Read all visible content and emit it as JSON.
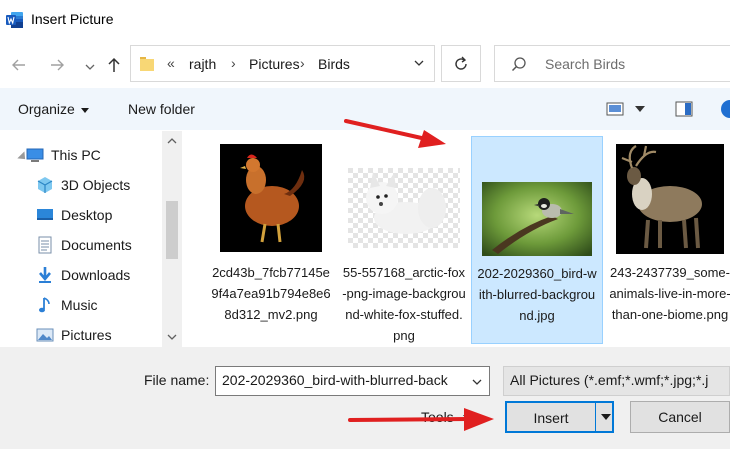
{
  "window": {
    "title": "Insert Picture",
    "app_icon": "word-icon"
  },
  "nav": {
    "back_icon": "back-arrow-icon",
    "forward_icon": "forward-arrow-icon",
    "up_icon": "up-arrow-icon",
    "overflow": "«",
    "breadcrumb": [
      "rajth",
      "Pictures",
      "Birds"
    ],
    "search_placeholder": "Search Birds"
  },
  "toolbar": {
    "organize_label": "Organize",
    "new_folder_label": "New folder"
  },
  "sidebar": {
    "items": [
      {
        "label": "This PC",
        "icon": "computer-icon"
      },
      {
        "label": "3D Objects",
        "icon": "cube-icon"
      },
      {
        "label": "Desktop",
        "icon": "desktop-icon"
      },
      {
        "label": "Documents",
        "icon": "document-icon"
      },
      {
        "label": "Downloads",
        "icon": "download-icon"
      },
      {
        "label": "Music",
        "icon": "music-note-icon"
      },
      {
        "label": "Pictures",
        "icon": "pictures-icon"
      }
    ]
  },
  "files": [
    {
      "name": "2cd43b_7fcb77145e9f4a7ea91b794e8e68d312_mv2.png",
      "selected": false
    },
    {
      "name": "55-557168_arctic-fox-png-image-background-white-fox-stuffed.png",
      "selected": false
    },
    {
      "name": "202-2029360_bird-with-blurred-background.jpg",
      "selected": true
    },
    {
      "name": "243-2437739_some-animals-live-in-more-than-one-biome.png",
      "selected": false
    }
  ],
  "footer": {
    "file_name_label": "File name:",
    "file_name_value": "202-2029360_bird-with-blurred-back",
    "filter_value": "All Pictures (*.emf;*.wmf;*.jpg;*.j",
    "tools_label": "Tools",
    "insert_label": "Insert",
    "cancel_label": "Cancel"
  },
  "colors": {
    "accent": "#0078d7",
    "selection": "#cce8ff",
    "annotation_arrow": "#e02020"
  }
}
